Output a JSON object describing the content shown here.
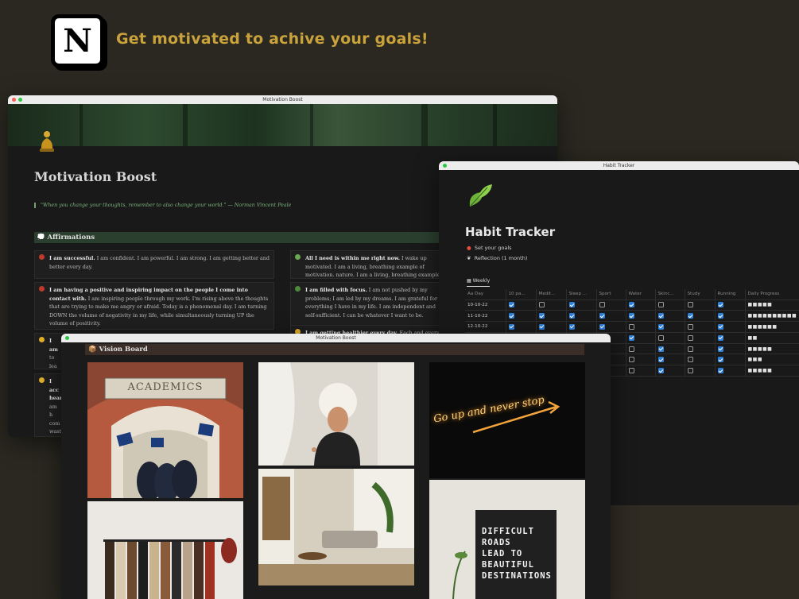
{
  "header": {
    "logo_letter": "N",
    "tagline": "Get motivated to achive your goals!",
    "tagline_color": "#c9a23c"
  },
  "win_motivation": {
    "title": "Motivation Boost",
    "page_title": "Motivation Boost",
    "quote": "\"When you change your thoughts, remember to also change your world.\" — Norman Vincent Peale",
    "affirmations_header": "💭 Affirmations",
    "cards": [
      {
        "bold": "I am successful.",
        "text": " I am confident. I am powerful. I am strong. I am getting better and better every day.",
        "icon": "rose-icon",
        "color": "#c0392b"
      },
      {
        "bold": "All I need is within me right now.",
        "text": " I wake up motivated. I am a living, breathing example of motivation. nature. I am a living, breathing example of motivation.",
        "icon": "green-circle-icon",
        "color": "#6aa84f"
      },
      {
        "bold": "I am having a positive and inspiring impact on the people I come into contact with.",
        "text": " I am inspiring people through my work. I'm rising above the thoughts that are trying to make me angry or afraid. Today is a phenomenal day. I am turning DOWN the volume of negativity in my life, while simultaneously turning UP the volume of positivity.",
        "icon": "red-flower-icon",
        "color": "#c0392b"
      },
      {
        "bold": "I am filled with focus.",
        "text": " I am not pushed by my problems; I am led by my dreams. I am grateful for everything I have in my life. I am independent and self-sufficient. I can be whatever I want to be.",
        "icon": "tree-icon",
        "color": "#4f8a3b"
      },
      {
        "bold": "I am",
        "text": " to lea more",
        "icon": "sunflower-icon",
        "color": "#e0b02a"
      },
      {
        "bold": "I am getting healthier every day.",
        "text": " Each and every day",
        "icon": "sun-icon",
        "color": "#e0b02a"
      },
      {
        "bold": "I acc hear",
        "text": " am h com wast on th",
        "icon": "cactus-icon",
        "color": "#e0b02a"
      }
    ]
  },
  "win_habit": {
    "title": "Habit Tracker",
    "page_title": "Habit Tracker",
    "links": [
      {
        "icon": "dart-icon",
        "label": "Set your goals"
      },
      {
        "icon": "feather-icon",
        "label": "Reflection (1 month)"
      }
    ],
    "tab": "Weekly",
    "columns": [
      "Aa Day",
      "10 pa...",
      "Medit...",
      "Sleep ...",
      "Sport",
      "Water",
      "Skinc...",
      "Study",
      "Running",
      "Daily Progress"
    ],
    "rows": [
      {
        "day": "10-10-22",
        "checks": [
          1,
          0,
          1,
          0,
          1,
          0,
          0,
          1
        ],
        "progress": "■■■■■"
      },
      {
        "day": "11-10-22",
        "checks": [
          1,
          1,
          1,
          1,
          1,
          1,
          1,
          1
        ],
        "progress": "■■■■■■■■■■"
      },
      {
        "day": "12-10-22",
        "checks": [
          1,
          1,
          1,
          1,
          0,
          1,
          0,
          1
        ],
        "progress": "■■■■■■"
      },
      {
        "day": "",
        "checks": [
          0,
          0,
          0,
          0,
          1,
          0,
          0,
          1
        ],
        "progress": "■■"
      },
      {
        "day": "",
        "checks": [
          0,
          0,
          0,
          0,
          0,
          1,
          0,
          1
        ],
        "progress": "■■■■■"
      },
      {
        "day": "",
        "checks": [
          0,
          0,
          0,
          0,
          0,
          1,
          0,
          1
        ],
        "progress": "■■■"
      },
      {
        "day": "",
        "checks": [
          0,
          0,
          0,
          0,
          0,
          1,
          0,
          1
        ],
        "progress": "■■■■■"
      }
    ]
  },
  "win_vision": {
    "title": "Motivation Boost",
    "header": "📦 Vision Board",
    "academics_sign": "ACADEMICS",
    "neon_text": "Go up and never stop",
    "letterboard": [
      "DIFFICULT",
      "ROADS",
      "LEAD TO",
      "BEAUTIFUL",
      "DESTINATIONS"
    ]
  }
}
